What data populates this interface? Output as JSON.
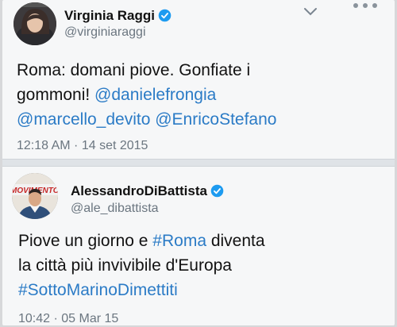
{
  "tweets": [
    {
      "author_name": "Virginia Raggi",
      "handle": "@virginiaraggi",
      "verified_icon": "verified-badge-icon",
      "line1": "Roma: domani piove. Gonfiate i",
      "line2_text": "gommoni! ",
      "line2_link": "@danielefrongia",
      "line3_link1": "@marcello_devito",
      "line3_link2": "@EnricoStefano",
      "timestamp": "12:18 AM · 14 set 2015"
    },
    {
      "author_name": "AlessandroDiBattista",
      "handle": "@ale_dibattista",
      "avatar_banner": "MOVIMENTO",
      "verified_icon": "verified-badge-icon",
      "line1_text": "Piove un giorno e ",
      "line1_link": "#Roma",
      "line1_rest": " diventa",
      "line2": "la città più invivibile d'Europa",
      "line3_link": "#SottoMarinoDimettiti",
      "timestamp": "10:42 · 05 Mar 15"
    }
  ],
  "colors": {
    "link": "#2b7bc6",
    "verified": "#1d9bf0",
    "muted_text": "#6b7680"
  }
}
